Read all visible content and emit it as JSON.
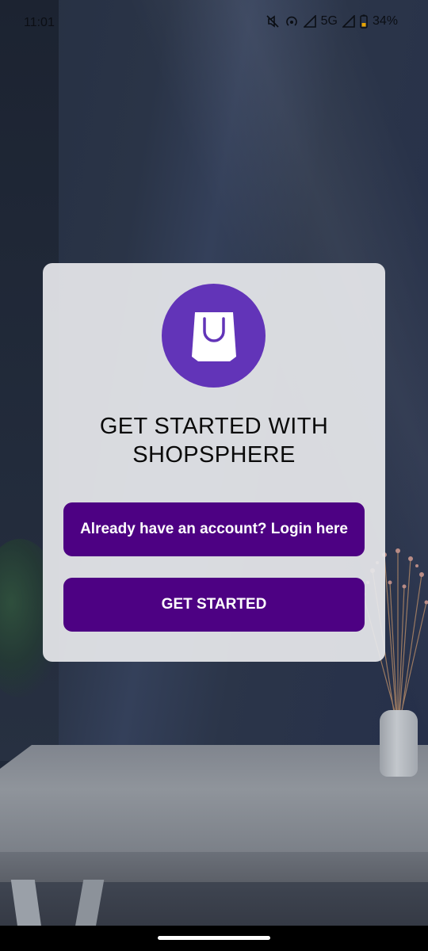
{
  "status_bar": {
    "time": "11:01",
    "network": "5G",
    "battery": "34%",
    "icons": [
      "mute-icon",
      "hotspot-icon",
      "signal-icon",
      "signal-icon",
      "battery-icon"
    ]
  },
  "card": {
    "title": "GET STARTED WITH\nSHOPSPHERE",
    "logo_icon": "shopping-bag-icon",
    "login_button": "Already have an account? Login here",
    "start_button": "GET STARTED"
  },
  "colors": {
    "brand_purple": "#6234b8",
    "button_purple": "#4d0183",
    "card_bg": "#e6e7eb"
  }
}
